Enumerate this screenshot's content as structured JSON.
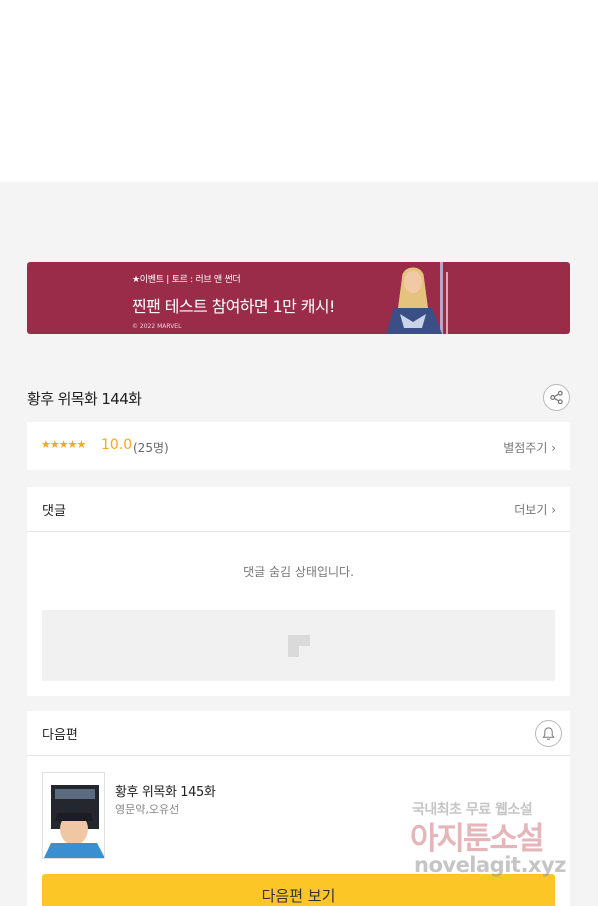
{
  "banner": {
    "kicker": "★이벤트 | 토르 : 러브 앤 썬더",
    "title": "찐팬 테스트 참여하면 1만 캐시!",
    "copyright": "© 2022 MARVEL"
  },
  "episode": {
    "title": "황후 위목화 144화"
  },
  "rating": {
    "stars": "★★★★★",
    "score": "10.0",
    "count": "(25명)",
    "rate_link": "별점주기 ›"
  },
  "comments": {
    "label": "댓글",
    "more": "더보기 ›",
    "hidden_message": "댓글 숨김 상태입니다."
  },
  "next": {
    "label": "다음편",
    "title": "황후 위목화 145화",
    "authors": "영문약,오유선",
    "button": "다음편 보기"
  },
  "watermark": {
    "line1": "국내최초 무료 웹소설",
    "line2": "아지툰소설",
    "line3": "novelagit.xyz"
  },
  "colors": {
    "banner_bg": "#9a2c4a",
    "rating_accent": "#f5a623",
    "next_button": "#fcc626"
  }
}
